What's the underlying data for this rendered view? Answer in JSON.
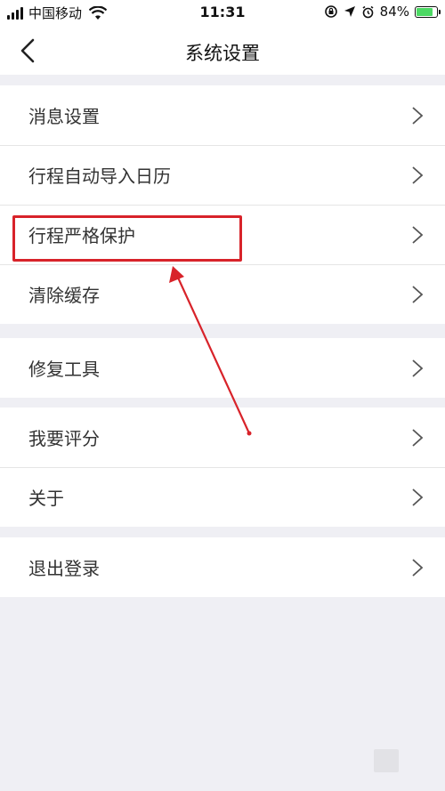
{
  "status_bar": {
    "carrier": "中国移动",
    "time": "11:31",
    "battery": "84%",
    "battery_level": 0.84
  },
  "nav": {
    "title": "系统设置"
  },
  "groups": [
    {
      "items": [
        "消息设置",
        "行程自动导入日历",
        "行程严格保护",
        "清除缓存"
      ]
    },
    {
      "items": [
        "修复工具"
      ]
    },
    {
      "items": [
        "我要评分",
        "关于"
      ]
    },
    {
      "items": [
        "退出登录"
      ]
    }
  ],
  "colors": {
    "highlight": "#d8232a",
    "battery": "#4cd964",
    "background": "#efeff4"
  },
  "icons": {
    "back": "chevron-left-icon",
    "row": "chevron-right-icon"
  }
}
